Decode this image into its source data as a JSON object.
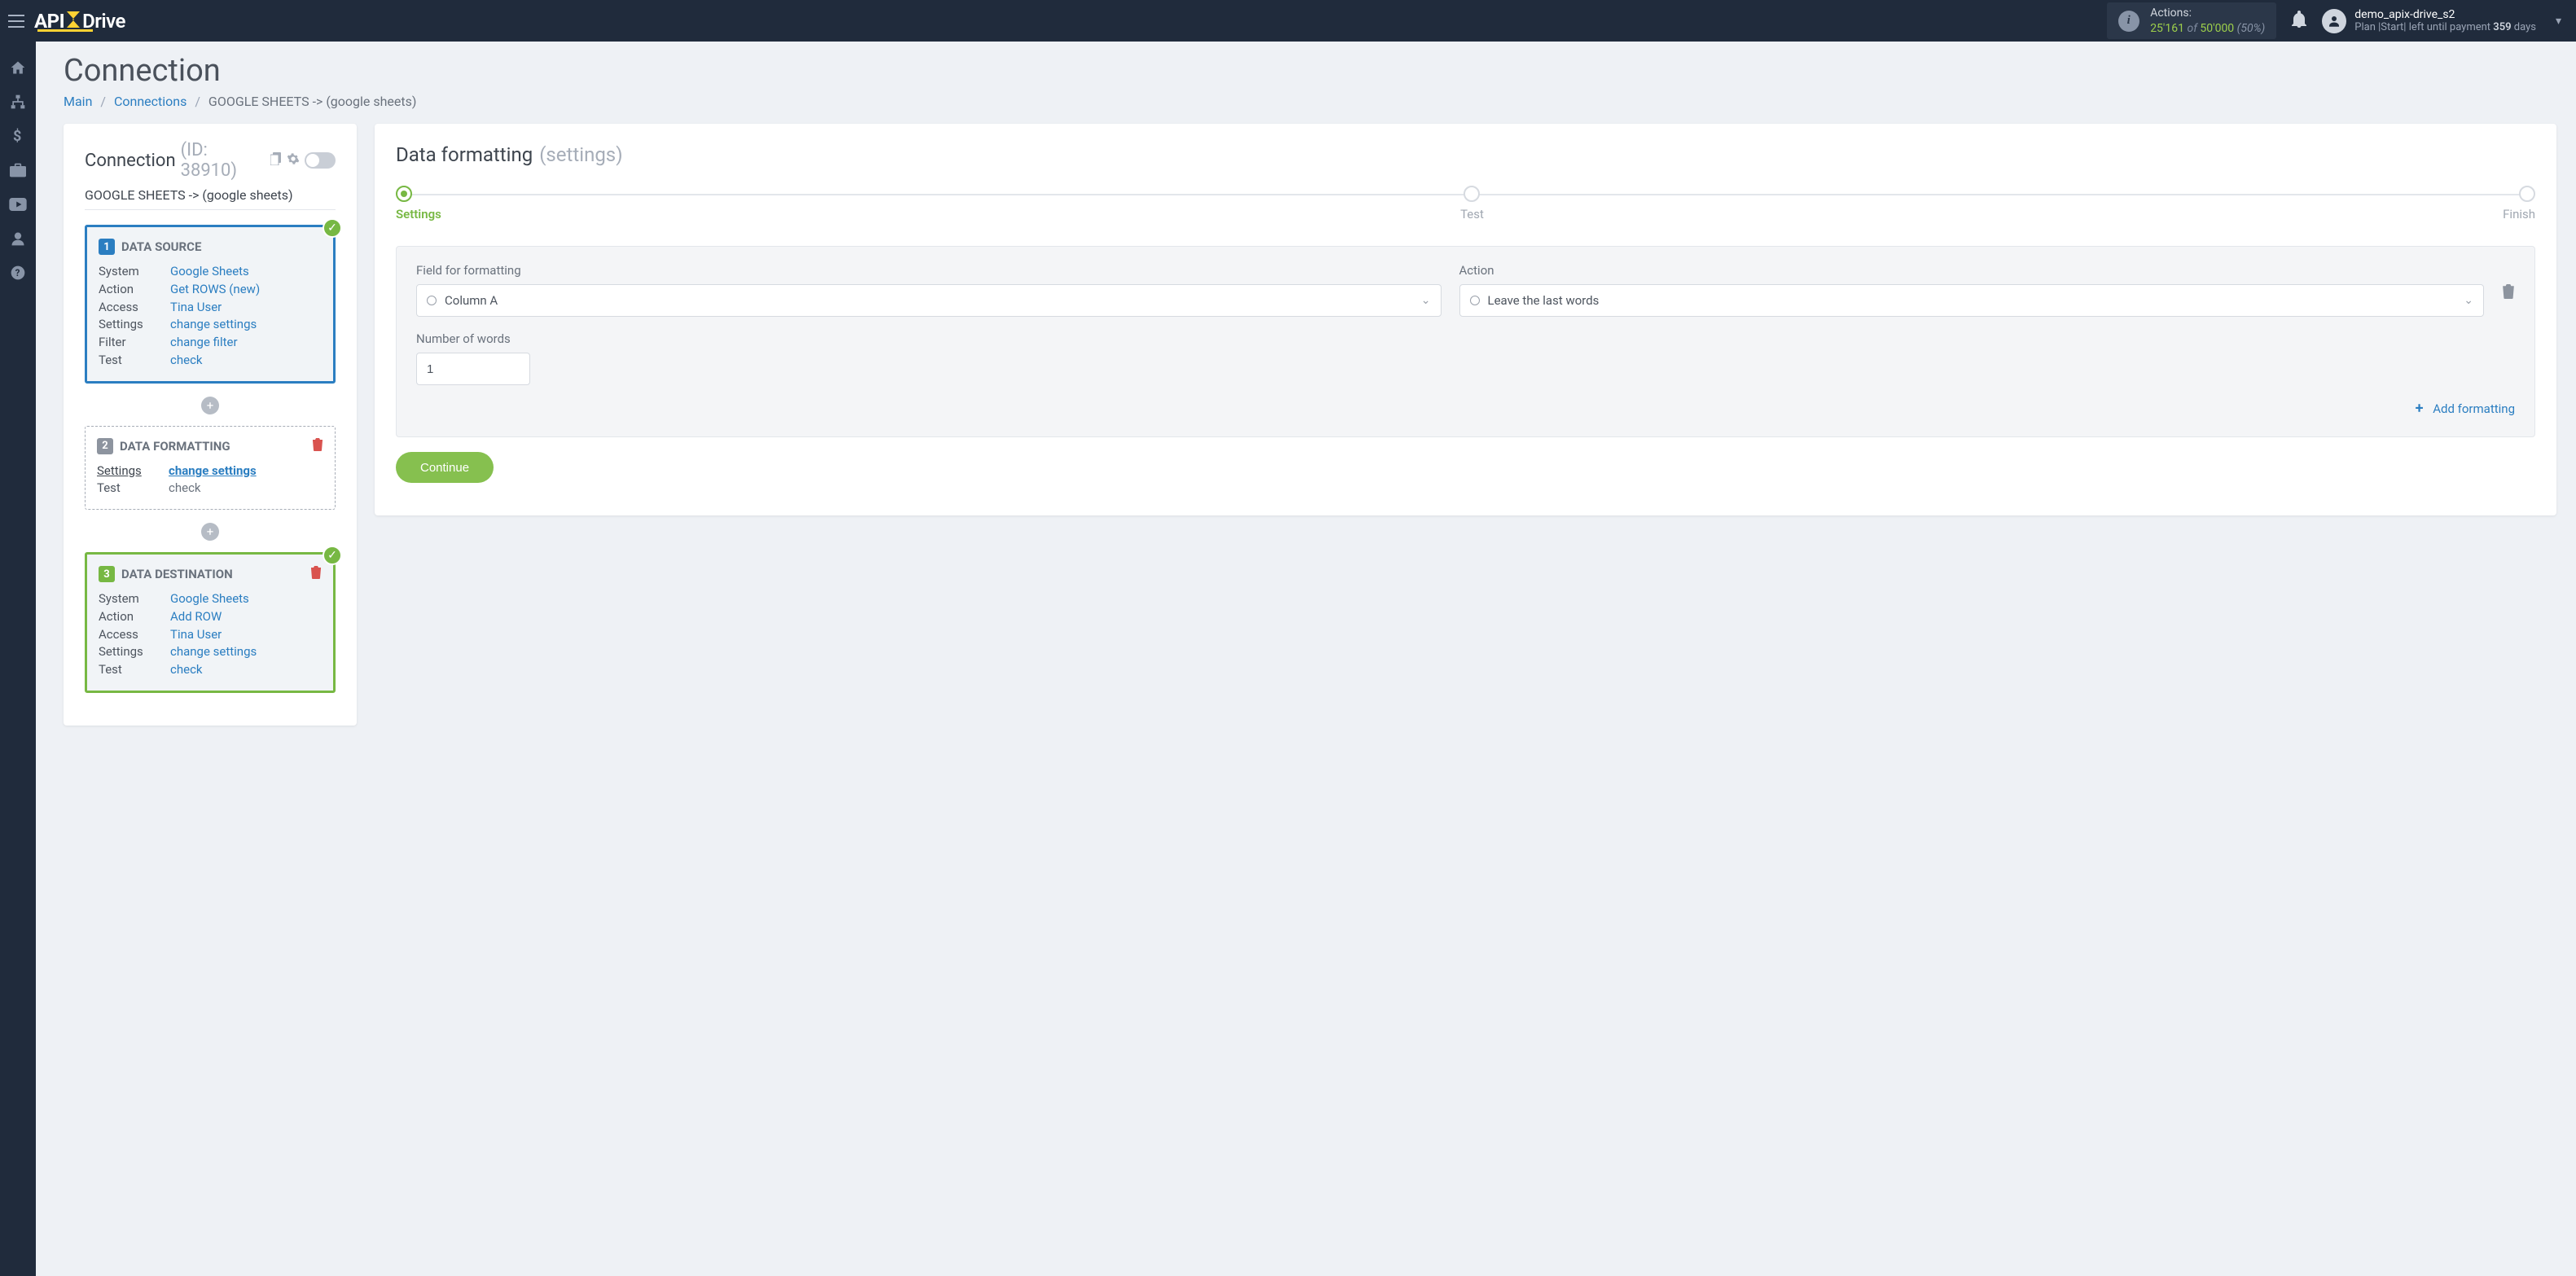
{
  "topbar": {
    "actions_label": "Actions:",
    "actions_used": "25'161",
    "actions_of": "of",
    "actions_total": "50'000",
    "actions_pct": "(50%)",
    "user_name": "demo_apix-drive_s2",
    "plan_prefix": "Plan |Start| left until payment ",
    "plan_days": "359",
    "plan_suffix": " days"
  },
  "sidebar_icons": [
    "home",
    "sitemap",
    "dollar",
    "briefcase",
    "youtube",
    "user",
    "help"
  ],
  "page": {
    "title": "Connection",
    "bc_main": "Main",
    "bc_connections": "Connections",
    "bc_current": "GOOGLE SHEETS -> (google sheets)"
  },
  "conn": {
    "title": "Connection",
    "id_label": "(ID: 38910)",
    "name": "GOOGLE SHEETS -> (google sheets)"
  },
  "card1": {
    "title": "DATA SOURCE",
    "rows": [
      {
        "k": "System",
        "v": "Google Sheets"
      },
      {
        "k": "Action",
        "v": "Get ROWS (new)"
      },
      {
        "k": "Access",
        "v": "Tina User"
      },
      {
        "k": "Settings",
        "v": "change settings"
      },
      {
        "k": "Filter",
        "v": "change filter"
      },
      {
        "k": "Test",
        "v": "check"
      }
    ]
  },
  "card2": {
    "title": "DATA FORMATTING",
    "rows": [
      {
        "k": "Settings",
        "v": "change settings",
        "active": true
      },
      {
        "k": "Test",
        "v": "check",
        "plain": true
      }
    ]
  },
  "card3": {
    "title": "DATA DESTINATION",
    "rows": [
      {
        "k": "System",
        "v": "Google Sheets"
      },
      {
        "k": "Action",
        "v": "Add ROW"
      },
      {
        "k": "Access",
        "v": "Tina User"
      },
      {
        "k": "Settings",
        "v": "change settings"
      },
      {
        "k": "Test",
        "v": "check"
      }
    ]
  },
  "right": {
    "title": "Data formatting",
    "subtitle": "(settings)",
    "steps": [
      "Settings",
      "Test",
      "Finish"
    ],
    "field_label": "Field for formatting",
    "field_value": "Column A",
    "action_label": "Action",
    "action_value": "Leave the last words",
    "num_label": "Number of words",
    "num_value": "1",
    "add_formatting": "Add formatting",
    "continue": "Continue"
  }
}
